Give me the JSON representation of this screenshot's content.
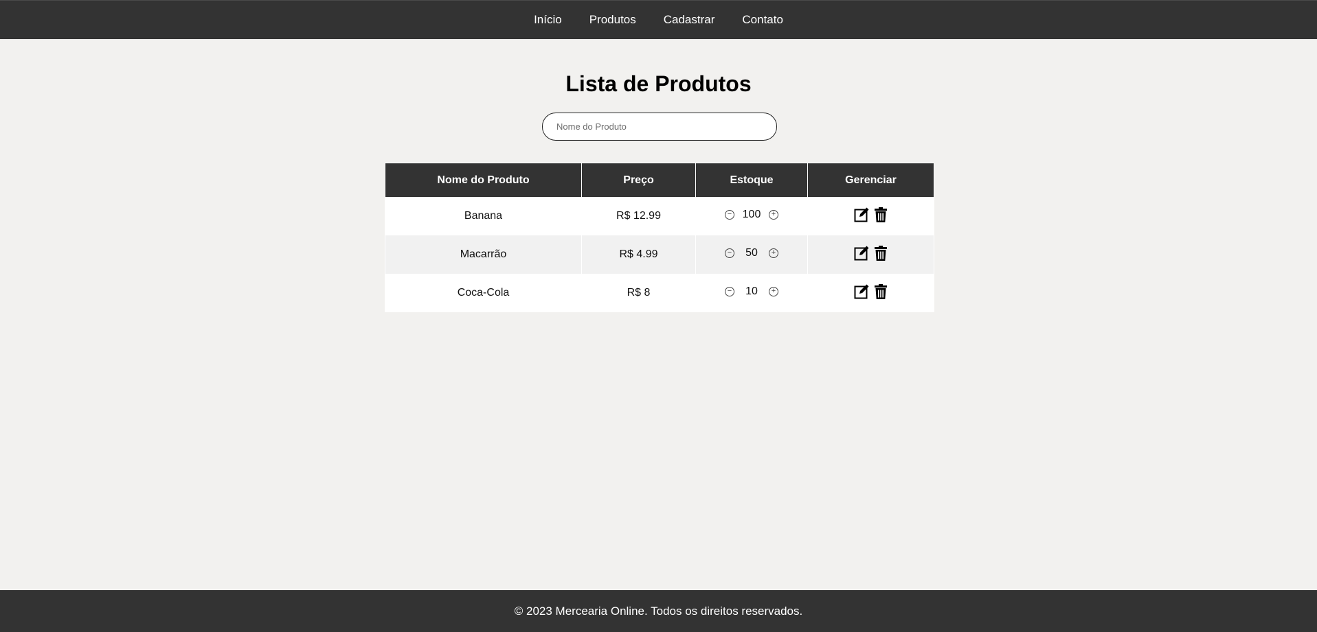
{
  "nav": {
    "items": [
      {
        "label": "Início"
      },
      {
        "label": "Produtos"
      },
      {
        "label": "Cadastrar"
      },
      {
        "label": "Contato"
      }
    ]
  },
  "page": {
    "title": "Lista de Produtos"
  },
  "search": {
    "placeholder": "Nome do Produto",
    "value": ""
  },
  "table": {
    "headers": [
      "Nome do Produto",
      "Preço",
      "Estoque",
      "Gerenciar"
    ],
    "rows": [
      {
        "name": "Banana",
        "price": "R$ 12.99",
        "stock": "100"
      },
      {
        "name": "Macarrão",
        "price": "R$ 4.99",
        "stock": "50"
      },
      {
        "name": "Coca-Cola",
        "price": "R$ 8",
        "stock": "10"
      }
    ],
    "stepper": {
      "decrement": "−",
      "increment": "+"
    }
  },
  "icons": {
    "edit": "edit-icon",
    "delete": "trash-icon",
    "decrement": "minus-circle-icon",
    "increment": "plus-circle-icon"
  },
  "footer": {
    "text": "© 2023 Mercearia Online. Todos os direitos reservados."
  },
  "colors": {
    "nav_bg": "#333333",
    "page_bg": "#f2f1ef",
    "header_bg": "#333333",
    "row_alt": "#f1f1f1"
  }
}
